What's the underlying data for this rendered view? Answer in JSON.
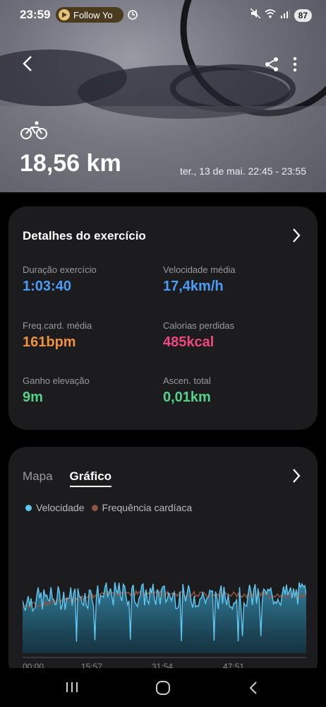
{
  "status": {
    "time": "23:59",
    "notification": "Follow Yo",
    "battery": "87"
  },
  "header": {
    "distance": "18,56 km",
    "date_range": "ter., 13 de mai. 22:45 - 23:55"
  },
  "details": {
    "title": "Detalhes do exercício",
    "stats": [
      {
        "label": "Duração exercício",
        "value": "1:03:40",
        "color": "#4a9cf6"
      },
      {
        "label": "Velocidade média",
        "value": "17,4km/h",
        "color": "#4a9cf6"
      },
      {
        "label": "Freq.card. média",
        "value": "161bpm",
        "color": "#f0913c"
      },
      {
        "label": "Calorias perdidas",
        "value": "485kcal",
        "color": "#f0477e"
      },
      {
        "label": "Ganho elevação",
        "value": "9m",
        "color": "#53d28a"
      },
      {
        "label": "Ascen. total",
        "value": "0,01km",
        "color": "#53d28a"
      }
    ]
  },
  "graph": {
    "tabs": [
      "Mapa",
      "Gráfico"
    ],
    "active_tab": "Gráfico",
    "legend": [
      {
        "name": "Velocidade",
        "color": "#5ec8f2"
      },
      {
        "name": "Frequência cardíaca",
        "color": "#8a5644"
      }
    ],
    "x_ticks": [
      "00:00",
      "15:57",
      "31:54",
      "47:51"
    ]
  },
  "chart_data": {
    "type": "area",
    "title": "",
    "xlabel": "",
    "ylabel": "",
    "x": [
      "00:00",
      "15:57",
      "31:54",
      "47:51"
    ],
    "series": [
      {
        "name": "Velocidade",
        "values": [
          17,
          19,
          18,
          19
        ]
      },
      {
        "name": "Frequência cardíaca",
        "values": [
          150,
          165,
          163,
          162
        ]
      }
    ]
  }
}
